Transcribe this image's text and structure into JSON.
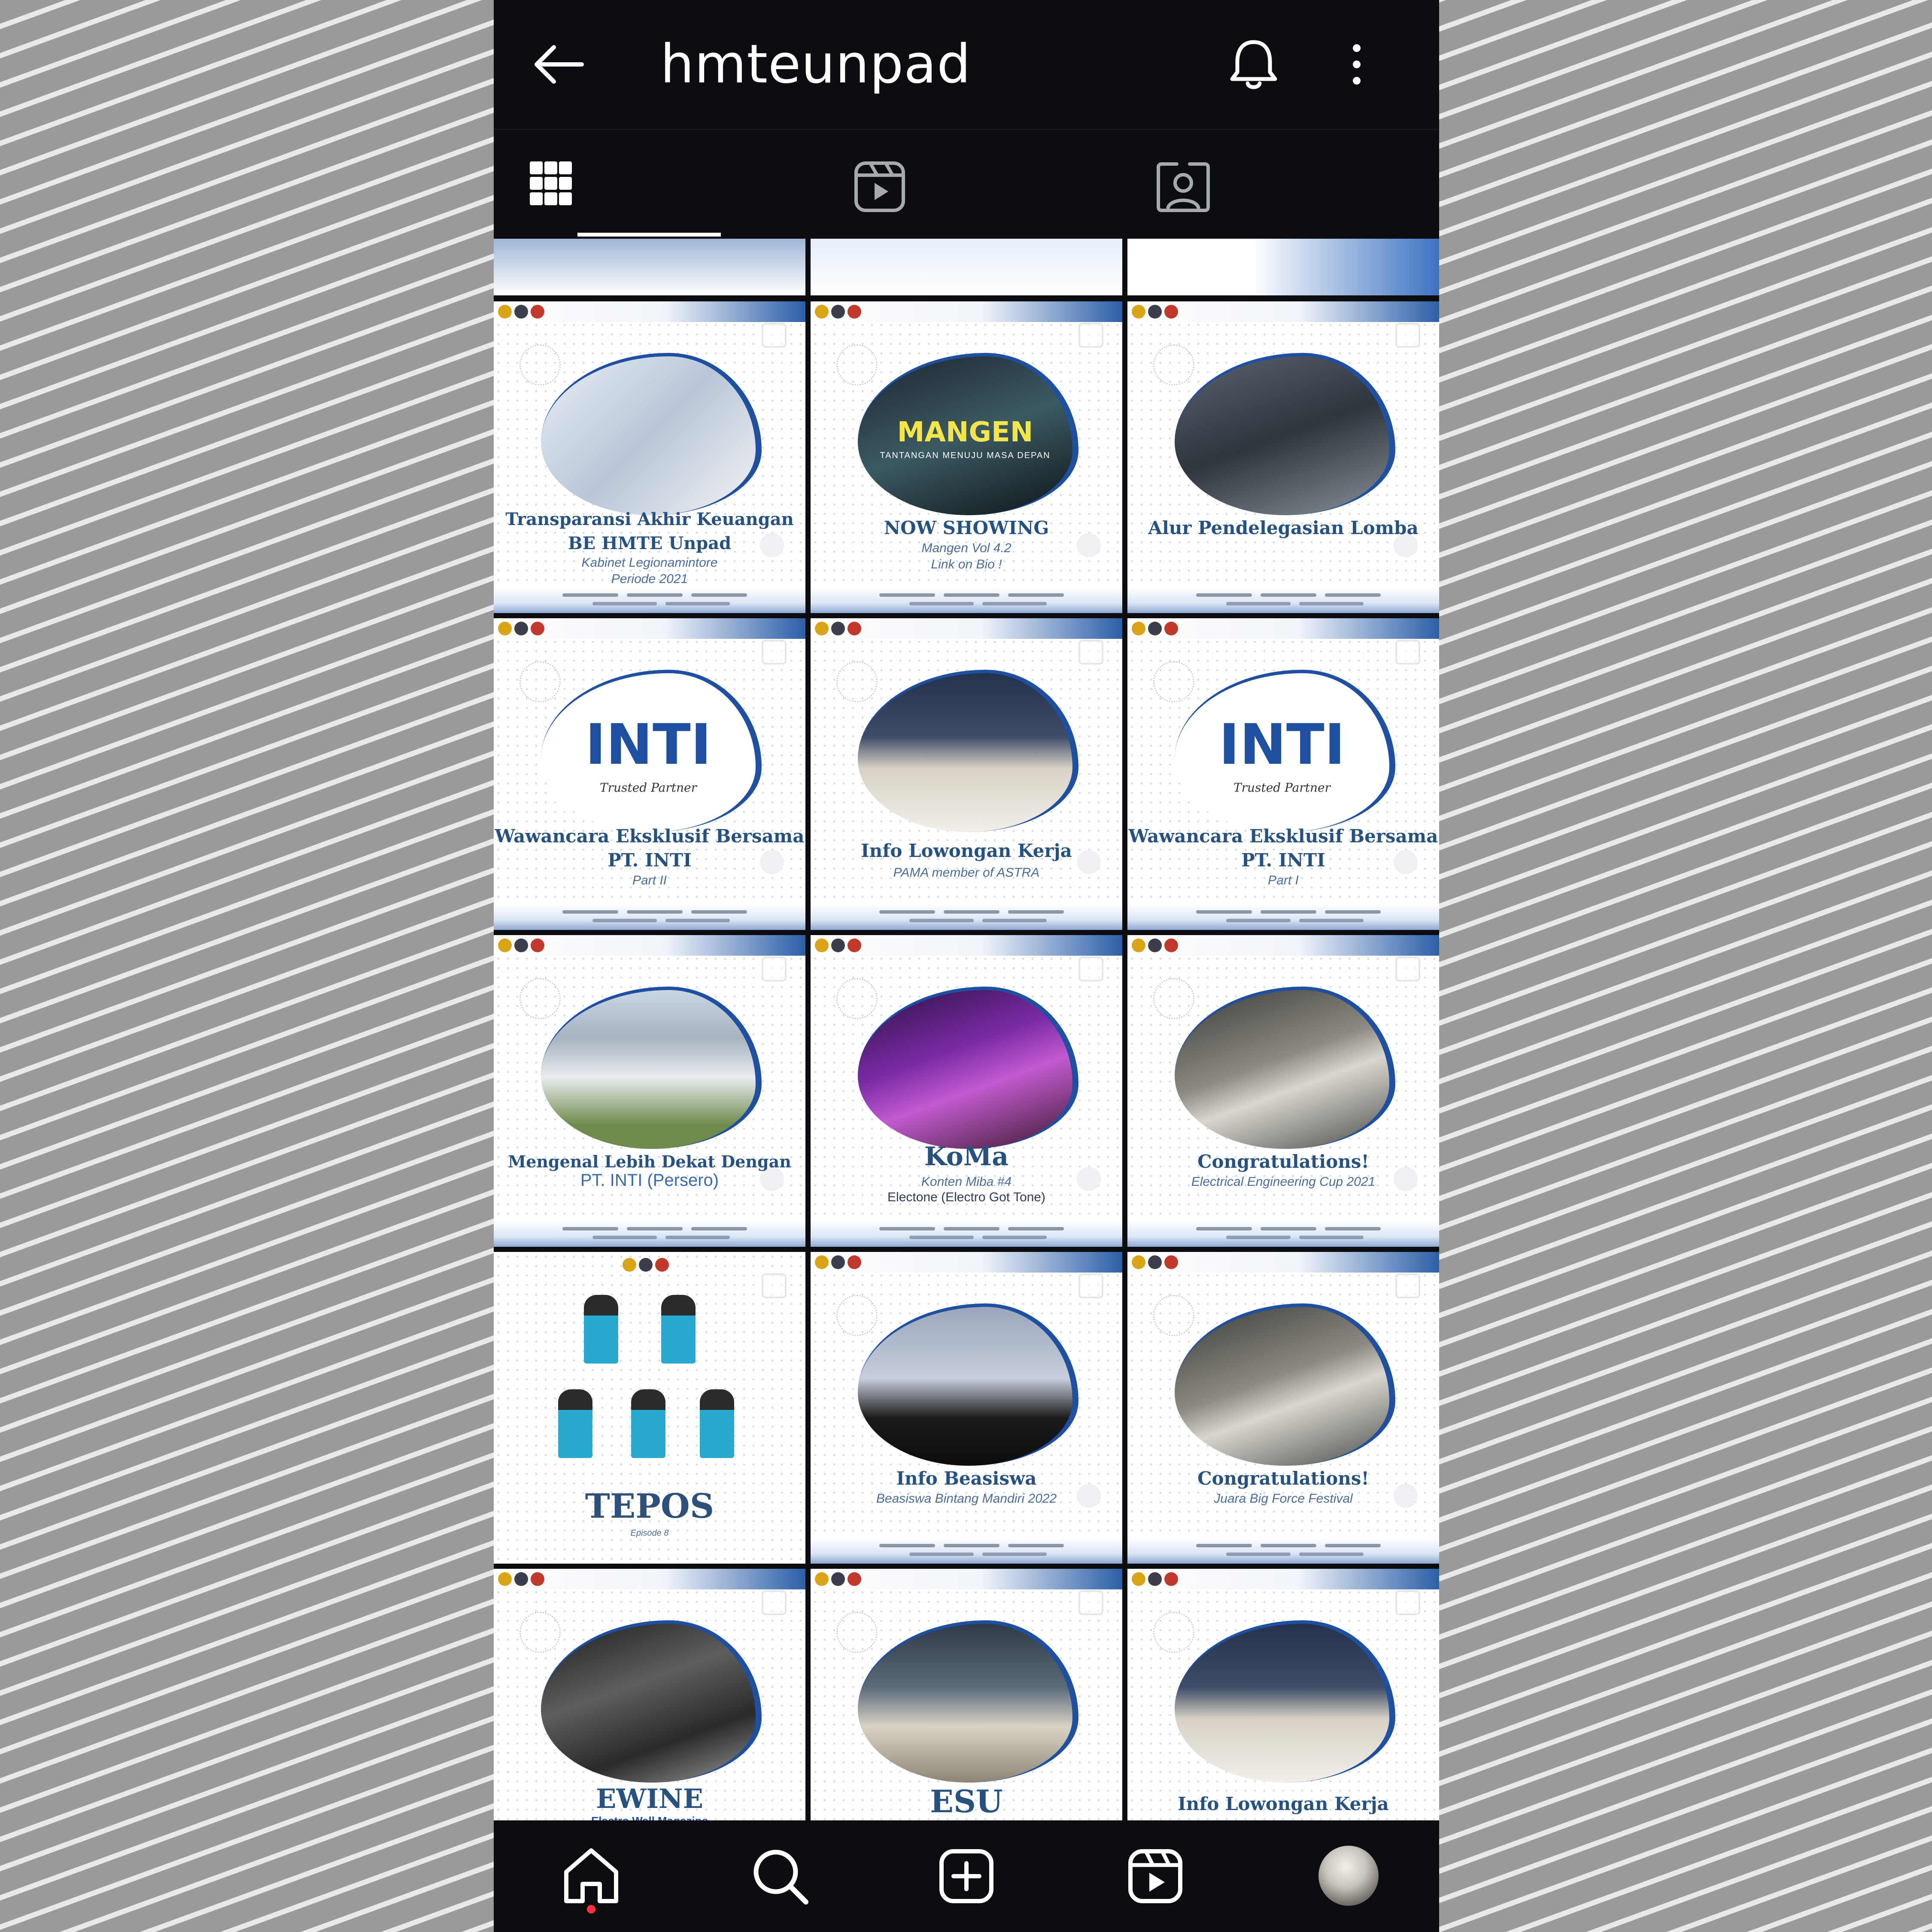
{
  "header": {
    "username": "hmteunpad",
    "back_icon": "arrow-left-icon",
    "notifications_icon": "bell-icon",
    "more_icon": "vertical-dots-icon"
  },
  "tabs": [
    {
      "name": "posts",
      "icon": "grid-icon",
      "active": true
    },
    {
      "name": "reels",
      "icon": "reels-icon",
      "active": false
    },
    {
      "name": "tagged",
      "icon": "tagged-user-icon",
      "active": false
    }
  ],
  "posts": [
    {
      "title": "Transparansi Akhir Keuangan BE HMTE Unpad",
      "subtitle": "Kabinet Legionamintore",
      "subtitle2": "Periode 2021",
      "multi": true
    },
    {
      "title": "NOW SHOWING",
      "subtitle": "Mangen Vol 4.2",
      "subtitle2": "Link on Bio !",
      "image_text": "MANGEN",
      "image_subtext": "TANTANGAN MENUJU MASA DEPAN",
      "multi": true
    },
    {
      "title": "Alur Pendelegasian Lomba",
      "subtitle": "",
      "subtitle2": "",
      "multi": true
    },
    {
      "title": "Wawancara Eksklusif Bersama PT. INTI",
      "subtitle": "Part II",
      "subtitle2": "",
      "image_text": "INTI",
      "image_subtext": "Trusted Partner",
      "reel": true
    },
    {
      "title": "Info Lowongan Kerja",
      "subtitle": "PAMA member of ASTRA",
      "subtitle2": "",
      "multi": true
    },
    {
      "title": "Wawancara Eksklusif Bersama PT. INTI",
      "subtitle": "Part I",
      "subtitle2": "",
      "image_text": "INTI",
      "image_subtext": "Trusted Partner",
      "reel": true
    },
    {
      "title": "Mengenal Lebih Dekat Dengan",
      "subtitle": "PT. INTI (Persero)",
      "subtitle2": "",
      "multi": true
    },
    {
      "title": "KoMa",
      "subtitle": "Konten Miba #4",
      "subtitle2": "Electone (Electro Got Tone)",
      "multi": true
    },
    {
      "title": "Congratulations!",
      "subtitle": "Electrical Engineering Cup 2021",
      "subtitle2": "",
      "multi": true
    },
    {
      "title": "TEPOS",
      "subtitle": "Episode 8",
      "subtitle2": "",
      "reel": true
    },
    {
      "title": "Info Beasiswa",
      "subtitle": "Beasiswa Bintang Mandiri 2022",
      "subtitle2": "",
      "multi": true
    },
    {
      "title": "Congratulations!",
      "subtitle": "Juara Big Force Festival",
      "subtitle2": "",
      "multi": true
    },
    {
      "title": "EWINE",
      "subtitle": "Electro Wall Magazine",
      "subtitle2": "",
      "multi": true
    },
    {
      "title": "ESU",
      "subtitle": "",
      "subtitle2": "",
      "multi": true
    },
    {
      "title": "Info Lowongan Kerja",
      "subtitle": "",
      "subtitle2": "",
      "multi": true
    }
  ],
  "bottom_nav": [
    {
      "name": "home",
      "icon": "home-icon",
      "active": true
    },
    {
      "name": "search",
      "icon": "search-icon"
    },
    {
      "name": "create",
      "icon": "plus-square-icon"
    },
    {
      "name": "reels",
      "icon": "reels-icon"
    },
    {
      "name": "profile",
      "icon": "avatar"
    }
  ],
  "colors": {
    "background": "#0b0d10",
    "text": "#ffffff",
    "accent_blue": "#1e4fa0",
    "title_blue": "#27527f",
    "notification_dot": "#ff3040"
  }
}
